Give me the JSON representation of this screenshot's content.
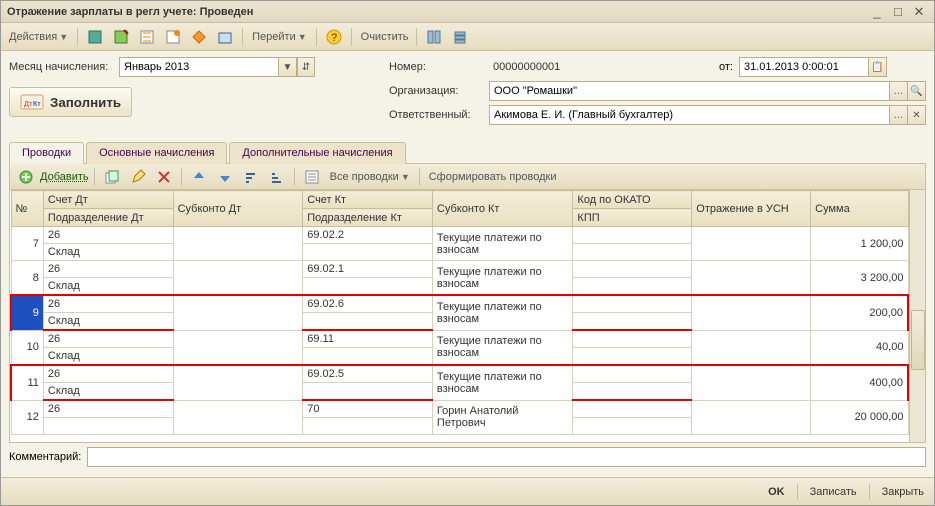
{
  "window": {
    "title": "Отражение зарплаты в регл учете: Проведен"
  },
  "toolbar": {
    "actions": "Действия",
    "go": "Перейти",
    "clear": "Очистить"
  },
  "form": {
    "month_label": "Месяц начисления:",
    "month_value": "Январь 2013",
    "number_label": "Номер:",
    "number_value": "00000000001",
    "date_label": "от:",
    "date_value": "31.01.2013 0:00:01",
    "org_label": "Организация:",
    "org_value": "ООО \"Ромашки\"",
    "resp_label": "Ответственный:",
    "resp_value": "Акимова Е. И. (Главный бухгалтер)",
    "fill_btn": "Заполнить"
  },
  "tabs": {
    "t1": "Проводки",
    "t2": "Основные начисления",
    "t3": "Дополнительные начисления"
  },
  "tab_tb": {
    "add": "Добавить",
    "all": "Все проводки",
    "form": "Сформировать проводки"
  },
  "grid": {
    "h_num": "№",
    "h_acc_dt": "Счет Дт",
    "h_sub_dt": "Субконто Дт",
    "h_acc_kt": "Счет Кт",
    "h_sub_kt": "Субконто Кт",
    "h_okato": "Код по ОКАТО",
    "h_usn": "Отражение в УСН",
    "h_sum": "Сумма",
    "h_podr_dt": "Подразделение Дт",
    "h_podr_kt": "Подразделение Кт",
    "h_kpp": "КПП",
    "rows": [
      {
        "n": "7",
        "acc_dt": "26",
        "podr_dt": "Склад",
        "acc_kt": "69.02.2",
        "sub_kt": "Текущие платежи по взносам",
        "sum": "1 200,00"
      },
      {
        "n": "8",
        "acc_dt": "26",
        "podr_dt": "Склад",
        "acc_kt": "69.02.1",
        "sub_kt": "Текущие платежи по взносам",
        "sum": "3 200,00"
      },
      {
        "n": "9",
        "acc_dt": "26",
        "podr_dt": "Склад",
        "acc_kt": "69.02.6",
        "sub_kt": "Текущие платежи по взносам",
        "sum": "200,00",
        "hl": true,
        "selected": true
      },
      {
        "n": "10",
        "acc_dt": "26",
        "podr_dt": "Склад",
        "acc_kt": "69.11",
        "sub_kt": "Текущие платежи по взносам",
        "sum": "40,00"
      },
      {
        "n": "11",
        "acc_dt": "26",
        "podr_dt": "Склад",
        "acc_kt": "69.02.5",
        "sub_kt": "Текущие платежи по взносам",
        "sum": "400,00",
        "hl": true
      },
      {
        "n": "12",
        "acc_dt": "26",
        "podr_dt": "",
        "acc_kt": "70",
        "sub_kt": "Горин Анатолий Петрович",
        "sum": "20 000,00"
      }
    ]
  },
  "comment_label": "Комментарий:",
  "footer": {
    "ok": "OK",
    "save": "Записать",
    "close": "Закрыть"
  }
}
